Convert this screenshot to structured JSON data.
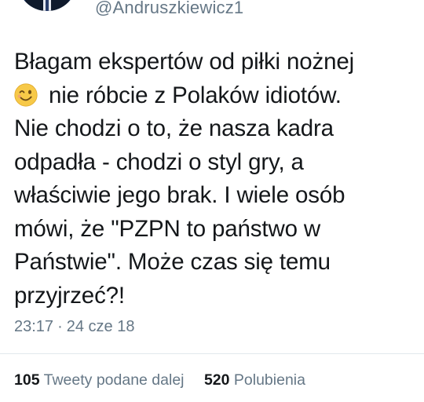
{
  "tweet": {
    "handle": "@Andruszkiewicz1",
    "avatar_icon": "user-avatar-photo",
    "text_lines": [
      "Błagam ekspertów od piłki nożnej",
      "nie róbcie z Polaków idiotów.",
      "Nie chodzi o to, że nasza kadra",
      "odpadła - chodzi o styl gry, a",
      "właściwie jego brak. I wiele osób",
      "mówi, że \"PZPN to państwo w",
      "Państwie\". Może czas się temu",
      "przyjrzeć?!"
    ],
    "emoji_icon": "winking-face-emoji",
    "time": "23:17",
    "separator": "·",
    "date": "24 cze 18",
    "retweets": {
      "count": "105",
      "label": "Tweety podane dalej"
    },
    "likes": {
      "count": "520",
      "label": "Polubienia"
    }
  },
  "colors": {
    "text": "#14171a",
    "secondary": "#657786",
    "divider": "#e1e8ed",
    "emoji": "#f7c948"
  }
}
